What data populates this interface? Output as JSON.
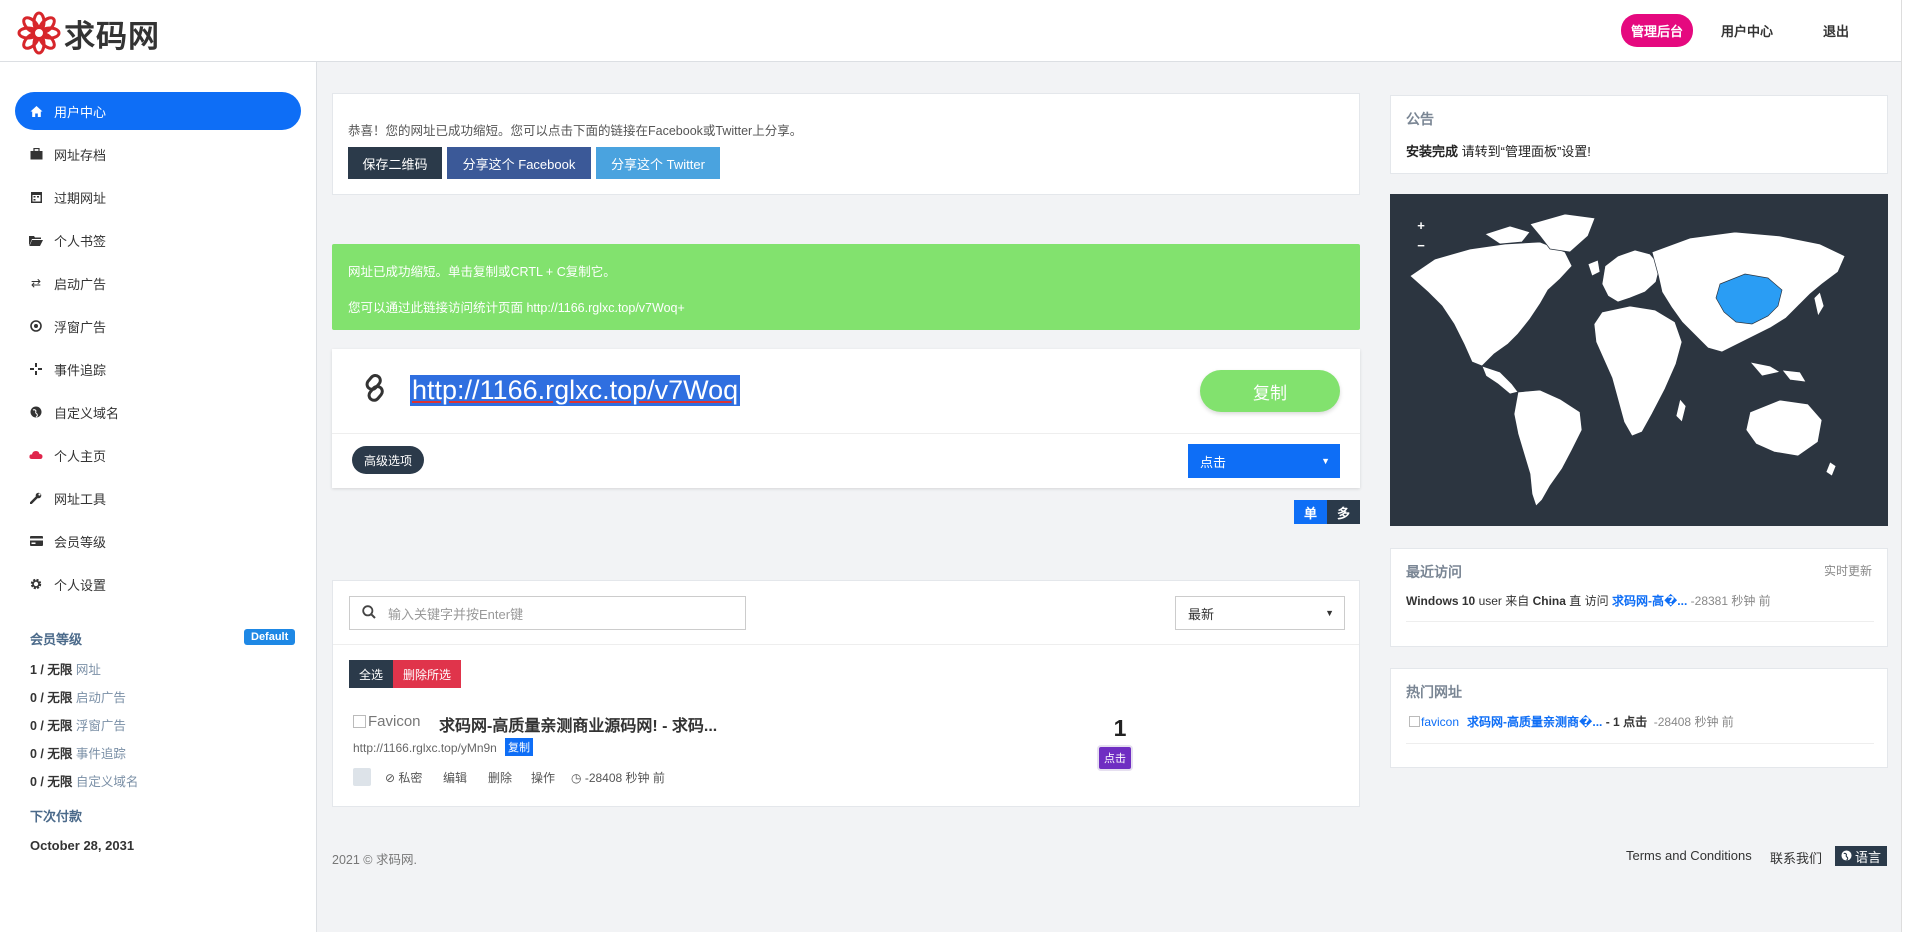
{
  "header": {
    "logo_text": "求码网",
    "admin_button": "管理后台",
    "user_center": "用户中心",
    "logout": "退出"
  },
  "sidebar": {
    "items": [
      {
        "label": "用户中心",
        "icon": "home-icon"
      },
      {
        "label": "网址存档",
        "icon": "briefcase-icon"
      },
      {
        "label": "过期网址",
        "icon": "calendar-icon"
      },
      {
        "label": "个人书签",
        "icon": "folder-icon"
      },
      {
        "label": "启动广告",
        "icon": "exchange-icon"
      },
      {
        "label": "浮窗广告",
        "icon": "dot-circle-icon"
      },
      {
        "label": "事件追踪",
        "icon": "crosshair-icon"
      },
      {
        "label": "自定义域名",
        "icon": "globe-icon"
      },
      {
        "label": "个人主页",
        "icon": "cloud-icon"
      },
      {
        "label": "网址工具",
        "icon": "wrench-icon"
      },
      {
        "label": "会员等级",
        "icon": "credit-card-icon"
      },
      {
        "label": "个人设置",
        "icon": "gear-icon"
      }
    ],
    "membership_title": "会员等级",
    "membership_badge": "Default",
    "quotas": [
      {
        "value": "1 / 无限",
        "label": "网址"
      },
      {
        "value": "0 / 无限",
        "label": "启动广告"
      },
      {
        "value": "0 / 无限",
        "label": "浮窗广告"
      },
      {
        "value": "0 / 无限",
        "label": "事件追踪"
      },
      {
        "value": "0 / 无限",
        "label": "自定义域名"
      }
    ],
    "next_payment_title": "下次付款",
    "next_payment_date": "October 28, 2031"
  },
  "share": {
    "text": "恭喜！您的网址已成功缩短。您可以点击下面的链接在Facebook或Twitter上分享。",
    "qr_button": "保存二维码",
    "facebook_button": "分享这个 Facebook",
    "twitter_button": "分享这个 Twitter",
    "colors": {
      "qr": "#2b3a4a",
      "facebook": "#3b5998",
      "twitter": "#4aa3df"
    }
  },
  "alert": {
    "line1": "网址已成功缩短。单击复制或CRTL + C复制它。",
    "line2": "您可以通过此链接访问统计页面 http://1166.rglxc.top/v7Woq+"
  },
  "shortener": {
    "url": "http://1166.rglxc.top/v7Woq",
    "copy_button": "复制",
    "advanced_button": "高级选项",
    "click_select": "点击",
    "toggle_single": "单",
    "toggle_multi": "多"
  },
  "links": {
    "search_placeholder": "输入关键字并按Enter键",
    "sort_value": "最新",
    "select_all": "全选",
    "delete_selected": "删除所选",
    "items": [
      {
        "favicon_alt": "Favicon",
        "title": "求码网-高质量亲测商业源码网! - 求码...",
        "short_url": "http://1166.rglxc.top/yMn9n",
        "copy_label": "复制",
        "private_label": "私密",
        "edit_label": "编辑",
        "delete_label": "删除",
        "action_label": "操作",
        "time": "-28408 秒钟 前",
        "clicks": "1",
        "clicks_label": "点击"
      }
    ]
  },
  "footer": {
    "copyright": "2021 © 求码网.",
    "terms": "Terms and Conditions",
    "contact": "联系我们",
    "language": "语言"
  },
  "notice": {
    "title": "公告",
    "bold": "安装完成",
    "text": " 请转到“管理面板”设置!"
  },
  "map": {
    "zoom_in": "+",
    "zoom_out": "−",
    "highlighted_country": "China",
    "highlight_color": "#2a9df4"
  },
  "recent": {
    "title": "最近访问",
    "realtime": "实时更新",
    "os": "Windows 10",
    "user_text": " user 来自 ",
    "country": "China",
    "direct_text": " 直 访问 ",
    "page": "求码网-高�...",
    "time": " -28381 秒钟 前"
  },
  "hot": {
    "title": "热门网址",
    "favicon_alt": "favicon",
    "page": "求码网-高质量亲测商�...",
    "clicks_text": " - 1 点击 ",
    "time": " -28408 秒钟 前"
  }
}
